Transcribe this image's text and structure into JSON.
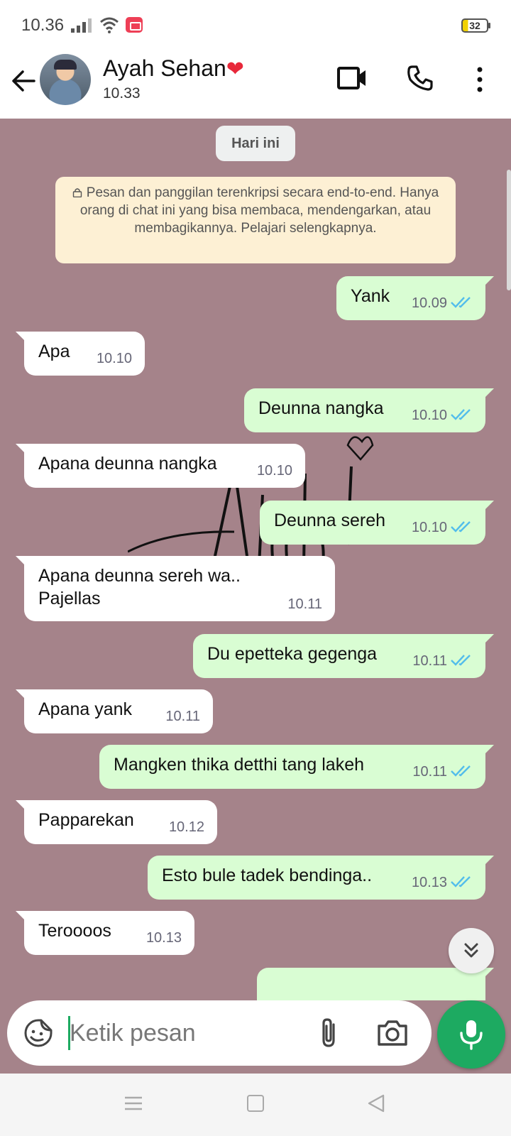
{
  "status_bar": {
    "time": "10.36",
    "battery": "32",
    "icons": [
      "signal-icon",
      "wifi-icon",
      "screen-record-icon",
      "battery-icon"
    ]
  },
  "header": {
    "contact_name": "Ayah Sehan",
    "name_emoji": "❤",
    "last_seen": "10.33",
    "icons": [
      "back-arrow-icon",
      "video-call-icon",
      "phone-icon",
      "more-options-icon"
    ]
  },
  "chat": {
    "date_chip": "Hari ini",
    "encryption_notice": "Pesan dan panggilan terenkripsi secara end-to-end. Hanya orang di chat ini yang bisa membaca, mendengarkan, atau membagikannya. Pelajari selengkapnya.",
    "messages": [
      {
        "direction": "out",
        "text": "Yank",
        "time": "10.09",
        "status": "read"
      },
      {
        "direction": "in",
        "text": "Apa",
        "time": "10.10"
      },
      {
        "direction": "out",
        "text": "Deunna nangka",
        "time": "10.10",
        "status": "read"
      },
      {
        "direction": "in",
        "text": "Apana deunna nangka",
        "time": "10.10"
      },
      {
        "direction": "out",
        "text": "Deunna sereh",
        "time": "10.10",
        "status": "read"
      },
      {
        "direction": "in",
        "text": "Apana deunna sereh wa.. Pajellas",
        "time": "10.11"
      },
      {
        "direction": "out",
        "text": "Du epetteka gegenga",
        "time": "10.11",
        "status": "read"
      },
      {
        "direction": "in",
        "text": "Apana yank",
        "time": "10.11"
      },
      {
        "direction": "out",
        "text": "Mangken thika detthi tang lakeh",
        "time": "10.11",
        "status": "read"
      },
      {
        "direction": "in",
        "text": "Papparekan",
        "time": "10.12"
      },
      {
        "direction": "out",
        "text": "Esto bule tadek bendinga..",
        "time": "10.13",
        "status": "read"
      },
      {
        "direction": "in",
        "text": "Teroooos",
        "time": "10.13"
      }
    ],
    "colors": {
      "wallpaper": "#a5838a",
      "outgoing_bubble": "#d9fdd3",
      "incoming_bubble": "#ffffff",
      "read_ticks": "#53bdeb",
      "accent": "#1daa61"
    }
  },
  "composer": {
    "placeholder": "Ketik pesan",
    "icons": [
      "sticker-icon",
      "attach-icon",
      "camera-icon",
      "mic-icon"
    ]
  },
  "nav": {
    "icons": [
      "menu-icon",
      "home-icon",
      "back-icon"
    ]
  }
}
